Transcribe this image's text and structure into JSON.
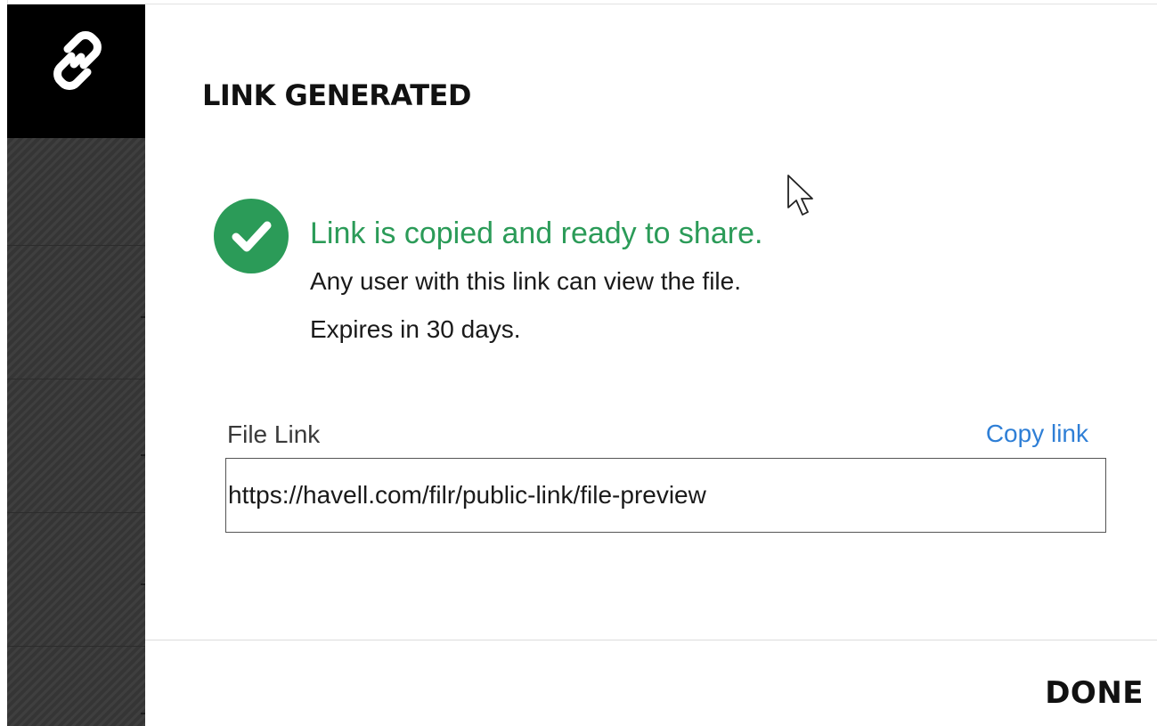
{
  "dialog": {
    "title": "LINK GENERATED",
    "header_icon": "chain-link-icon"
  },
  "status": {
    "icon": "check-circle-icon",
    "color": "#2b9b58",
    "title": "Link is copied and ready to share.",
    "description": "Any user with this link can view the file.",
    "expiry": "Expires in 30 days."
  },
  "file_link": {
    "label": "File Link",
    "copy_label": "Copy link",
    "value": "https://havell.com/filr/public-link/file-preview"
  },
  "footer": {
    "done_label": "DONE"
  },
  "colors": {
    "accent": "#2f7fd6",
    "success": "#2b9b58",
    "side_panel": "#3a3a3a"
  }
}
